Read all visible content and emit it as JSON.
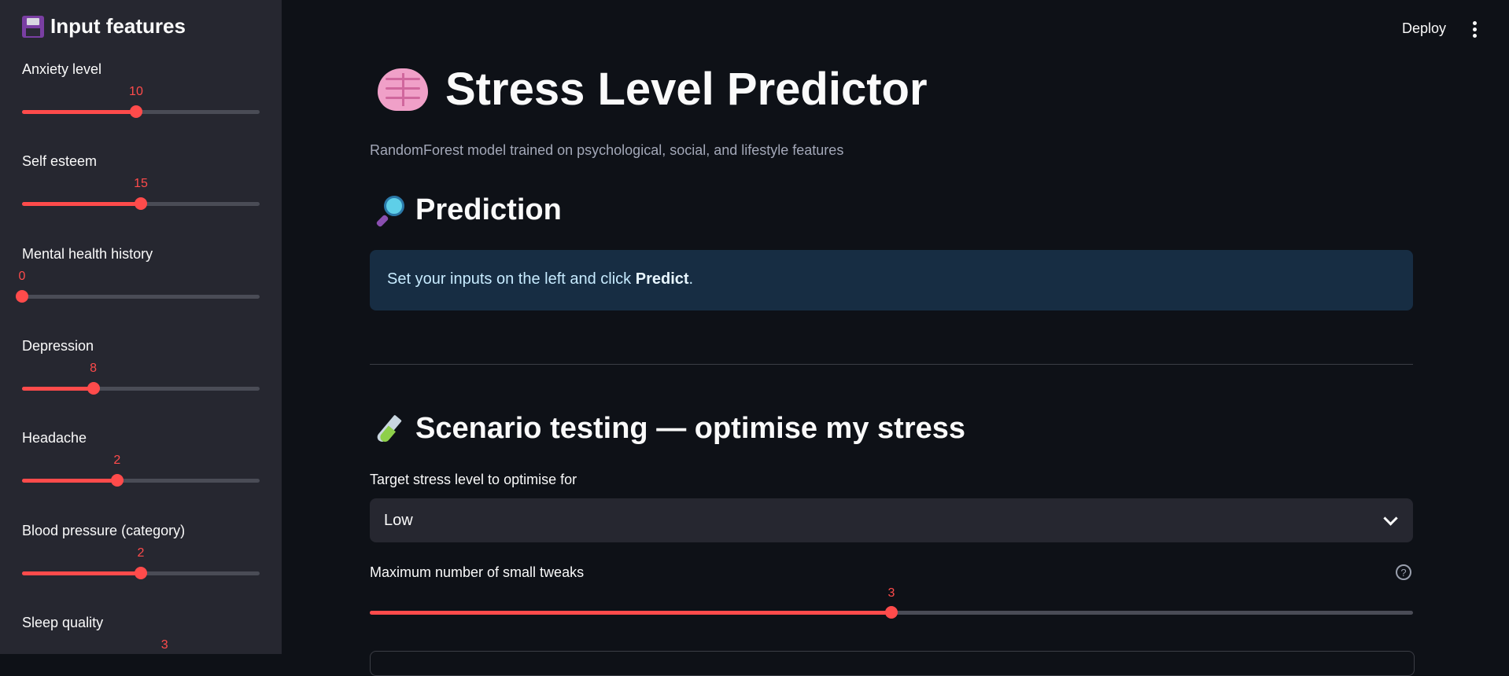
{
  "sidebar": {
    "title": "Input features",
    "title_icon": "floppy-disk-icon",
    "sliders": [
      {
        "label": "Anxiety level",
        "value": 10,
        "fraction": 0.48
      },
      {
        "label": "Self esteem",
        "value": 15,
        "fraction": 0.5
      },
      {
        "label": "Mental health history",
        "value": 0,
        "fraction": 0.0
      },
      {
        "label": "Depression",
        "value": 8,
        "fraction": 0.3
      },
      {
        "label": "Headache",
        "value": 2,
        "fraction": 0.4
      },
      {
        "label": "Blood pressure (category)",
        "value": 2,
        "fraction": 0.5
      },
      {
        "label": "Sleep quality",
        "value": 3,
        "fraction": 0.6
      }
    ]
  },
  "header": {
    "deploy_label": "Deploy",
    "menu_icon": "kebab-menu-icon"
  },
  "main": {
    "title": "Stress Level Predictor",
    "title_icon": "brain-icon",
    "subtitle": "RandomForest model trained on psychological, social, and lifestyle features",
    "prediction": {
      "heading": "Prediction",
      "heading_icon": "magnifying-glass-icon",
      "info_prefix": "Set your inputs on the left and click ",
      "info_bold": "Predict",
      "info_suffix": "."
    },
    "scenario": {
      "heading": "Scenario testing — optimise my stress",
      "heading_icon": "test-tube-icon",
      "target_label": "Target stress level to optimise for",
      "target_value": "Low",
      "tweaks_label": "Maximum number of small tweaks",
      "tweaks_value": 3,
      "tweaks_fraction": 0.5
    }
  },
  "colors": {
    "accent": "#ff4b4b",
    "background": "#0e1117",
    "sidebar": "#262730",
    "info_bg": "#172d43"
  }
}
